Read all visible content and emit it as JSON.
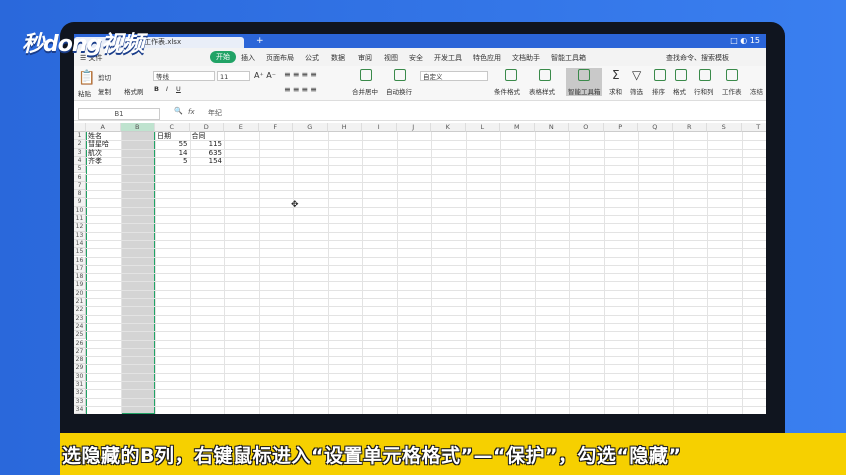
{
  "brand": {
    "logo_text": "秒dong视频"
  },
  "window": {
    "file_tab": "工作表.xlsx",
    "new_tab": "+",
    "win_controls": "□ ◐ 15"
  },
  "menu": {
    "file": "☰ 文件",
    "tabs": [
      "开始",
      "插入",
      "页面布局",
      "公式",
      "数据",
      "审阅",
      "视图",
      "安全",
      "开发工具",
      "特色应用",
      "文档助手",
      "智能工具箱"
    ],
    "search": "查找命令、搜索模板"
  },
  "ribbon": {
    "cut": "剪切",
    "copy": "复制",
    "format_painter": "格式刷",
    "paste": "粘贴",
    "font_name": "等线",
    "font_size": "11",
    "merge_center": "合并居中",
    "wrap": "自动换行",
    "number_format": "自定义",
    "cond_format": "条件格式",
    "table_style": "表格样式",
    "smart_toolbox": "智能工具箱",
    "sum": "求和",
    "filter": "筛选",
    "sort": "排序",
    "format": "格式",
    "rows_cols": "行和列",
    "sheet": "工作表",
    "freeze": "冻结"
  },
  "formula_bar": {
    "name_box": "B1",
    "fx": "fx",
    "content": "年纪"
  },
  "sheet": {
    "columns": [
      "A",
      "B",
      "C",
      "D",
      "E",
      "F",
      "G",
      "H",
      "I",
      "J",
      "K",
      "L",
      "M",
      "N",
      "O",
      "P",
      "Q",
      "R",
      "S",
      "T"
    ],
    "rows": [
      "1",
      "2",
      "3",
      "4",
      "5",
      "6",
      "7",
      "8",
      "9",
      "10",
      "11",
      "12",
      "13",
      "14",
      "15",
      "16",
      "17",
      "18",
      "19",
      "20",
      "21",
      "22",
      "23",
      "24",
      "25",
      "26",
      "27",
      "28",
      "29",
      "30",
      "31",
      "32",
      "33",
      "34"
    ],
    "cells": [
      {
        "col": "A",
        "row": "1",
        "value": "姓名"
      },
      {
        "col": "C",
        "row": "1",
        "value": "日期"
      },
      {
        "col": "D",
        "row": "1",
        "value": "合同"
      },
      {
        "col": "A",
        "row": "2",
        "value": "彗星哈"
      },
      {
        "col": "C",
        "row": "2",
        "value": "55"
      },
      {
        "col": "D",
        "row": "2",
        "value": "115"
      },
      {
        "col": "A",
        "row": "3",
        "value": "航次"
      },
      {
        "col": "C",
        "row": "3",
        "value": "14"
      },
      {
        "col": "D",
        "row": "3",
        "value": "635"
      },
      {
        "col": "A",
        "row": "4",
        "value": "齐孝"
      },
      {
        "col": "C",
        "row": "4",
        "value": "5"
      },
      {
        "col": "D",
        "row": "4",
        "value": "154"
      }
    ]
  },
  "caption": {
    "text": "选隐藏的B列，右键鼠标进入“设置单元格格式”—“保护”，勾选“隐藏”"
  },
  "colors": {
    "accent_green": "#21a366",
    "wps_blue": "#2b65d8",
    "caption_yellow": "#f6d000"
  }
}
